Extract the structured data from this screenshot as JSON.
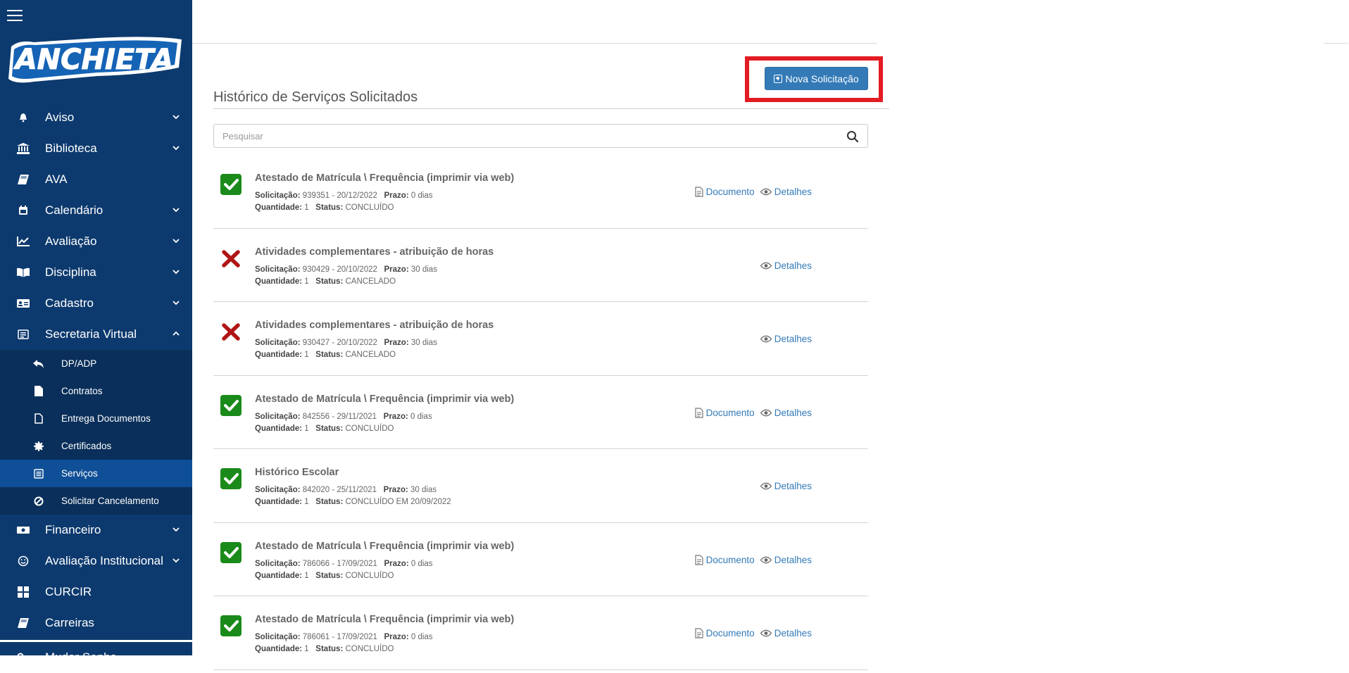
{
  "sidebar": {
    "logo_text": "ANCHIETA",
    "items": [
      {
        "label": "Aviso",
        "icon": "bell-icon",
        "expanded": false
      },
      {
        "label": "Biblioteca",
        "icon": "bank-icon",
        "expanded": false
      },
      {
        "label": "AVA",
        "icon": "book-icon",
        "expanded": null
      },
      {
        "label": "Calendário",
        "icon": "calendar-icon",
        "expanded": false
      },
      {
        "label": "Avaliação",
        "icon": "chart-line-icon",
        "expanded": false
      },
      {
        "label": "Disciplina",
        "icon": "open-book-icon",
        "expanded": false
      },
      {
        "label": "Cadastro",
        "icon": "id-card-icon",
        "expanded": false
      },
      {
        "label": "Secretaria Virtual",
        "icon": "newspaper-icon",
        "expanded": true
      }
    ],
    "subitems": [
      {
        "label": "DP/ADP",
        "icon": "reply-icon"
      },
      {
        "label": "Contratos",
        "icon": "file-icon"
      },
      {
        "label": "Entrega Documentos",
        "icon": "file-outline-icon"
      },
      {
        "label": "Certificados",
        "icon": "certificate-icon"
      },
      {
        "label": "Serviços",
        "icon": "list-icon",
        "active": true
      },
      {
        "label": "Solicitar Cancelamento",
        "icon": "ban-icon"
      }
    ],
    "items_after": [
      {
        "label": "Financeiro",
        "icon": "money-icon",
        "expanded": false
      },
      {
        "label": "Avaliação Institucional",
        "icon": "smile-icon",
        "expanded": false
      },
      {
        "label": "CURCIR",
        "icon": "grid-icon",
        "expanded": null
      },
      {
        "label": "Carreiras",
        "icon": "book-icon",
        "expanded": null
      },
      {
        "label": "Mudar Senha",
        "icon": "key-icon",
        "expanded": null
      }
    ]
  },
  "main": {
    "new_request_label": "Nova Solicitação",
    "title": "Histórico de Serviços Solicitados",
    "search_placeholder": "Pesquisar",
    "labels": {
      "solicitacao": "Solicitação:",
      "prazo": "Prazo:",
      "quantidade": "Quantidade:",
      "status": "Status:",
      "documento": "Documento",
      "detalhes": "Detalhes"
    },
    "requests": [
      {
        "title": "Atestado de Matrícula \\ Frequência (imprimir via web)",
        "solicitacao": "939351 - 20/12/2022",
        "prazo": "0 dias",
        "quantidade": "1",
        "status": "CONCLUÍDO",
        "state": "ok",
        "has_document": true
      },
      {
        "title": "Atividades complementares - atribuição de horas",
        "solicitacao": "930429 - 20/10/2022",
        "prazo": "30 dias",
        "quantidade": "1",
        "status": "CANCELADO",
        "state": "cancelled",
        "has_document": false
      },
      {
        "title": "Atividades complementares - atribuição de horas",
        "solicitacao": "930427 - 20/10/2022",
        "prazo": "30 dias",
        "quantidade": "1",
        "status": "CANCELADO",
        "state": "cancelled",
        "has_document": false
      },
      {
        "title": "Atestado de Matrícula \\ Frequência (imprimir via web)",
        "solicitacao": "842556 - 29/11/2021",
        "prazo": "0 dias",
        "quantidade": "1",
        "status": "CONCLUÍDO",
        "state": "ok",
        "has_document": true
      },
      {
        "title": "Histórico Escolar",
        "solicitacao": "842020 - 25/11/2021",
        "prazo": "30 dias",
        "quantidade": "1",
        "status": "CONCLUÍDO EM 20/09/2022",
        "state": "ok",
        "has_document": false
      },
      {
        "title": "Atestado de Matrícula \\ Frequência (imprimir via web)",
        "solicitacao": "786066 - 17/09/2021",
        "prazo": "0 dias",
        "quantidade": "1",
        "status": "CONCLUÍDO",
        "state": "ok",
        "has_document": true
      },
      {
        "title": "Atestado de Matrícula \\ Frequência (imprimir via web)",
        "solicitacao": "786061 - 17/09/2021",
        "prazo": "0 dias",
        "quantidade": "1",
        "status": "CONCLUÍDO",
        "state": "ok",
        "has_document": true
      }
    ]
  },
  "colors": {
    "sidebar_bg": "#0d3a6e",
    "active_bg": "#0f4f97",
    "button_bg": "#337ab7",
    "highlight": "#e31b23",
    "ok": "#1a8a1a",
    "cancel": "#b01515"
  }
}
